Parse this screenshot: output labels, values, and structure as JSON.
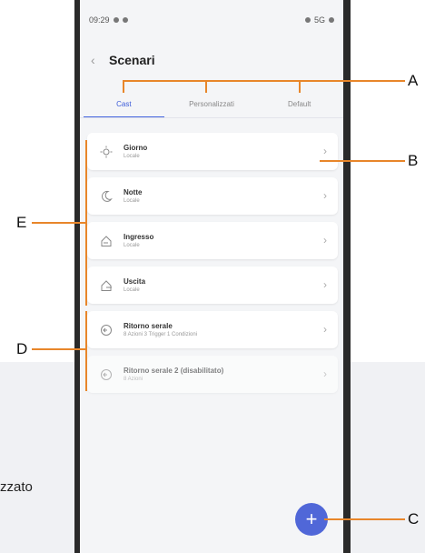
{
  "side_text": "zzato",
  "status": {
    "time": "09:29",
    "right": "5G"
  },
  "header": {
    "title": "Scenari"
  },
  "tabs": [
    {
      "label": "Cast",
      "active": true
    },
    {
      "label": "Personalizzati",
      "active": false
    },
    {
      "label": "Default",
      "active": false
    }
  ],
  "scenarios": [
    {
      "name": "Giorno",
      "sub": "Locale",
      "icon": "sun-icon"
    },
    {
      "name": "Notte",
      "sub": "Locale",
      "icon": "moon-icon"
    },
    {
      "name": "Ingresso",
      "sub": "Locale",
      "icon": "home-enter-icon"
    },
    {
      "name": "Uscita",
      "sub": "Locale",
      "icon": "home-exit-icon"
    },
    {
      "name": "Ritorno serale",
      "sub": "8 Azioni 3 Trigger 1 Condizioni",
      "icon": "return-icon"
    },
    {
      "name": "Ritorno serale 2 (disabilitato)",
      "sub": "8 Azioni",
      "icon": "return-icon",
      "disabled": true
    }
  ],
  "fab": {
    "label": "+"
  },
  "callouts": {
    "a": "A",
    "b": "B",
    "c": "C",
    "d": "D",
    "e": "E"
  },
  "colors": {
    "accent": "#4566e0",
    "annotation": "#e8862a"
  }
}
